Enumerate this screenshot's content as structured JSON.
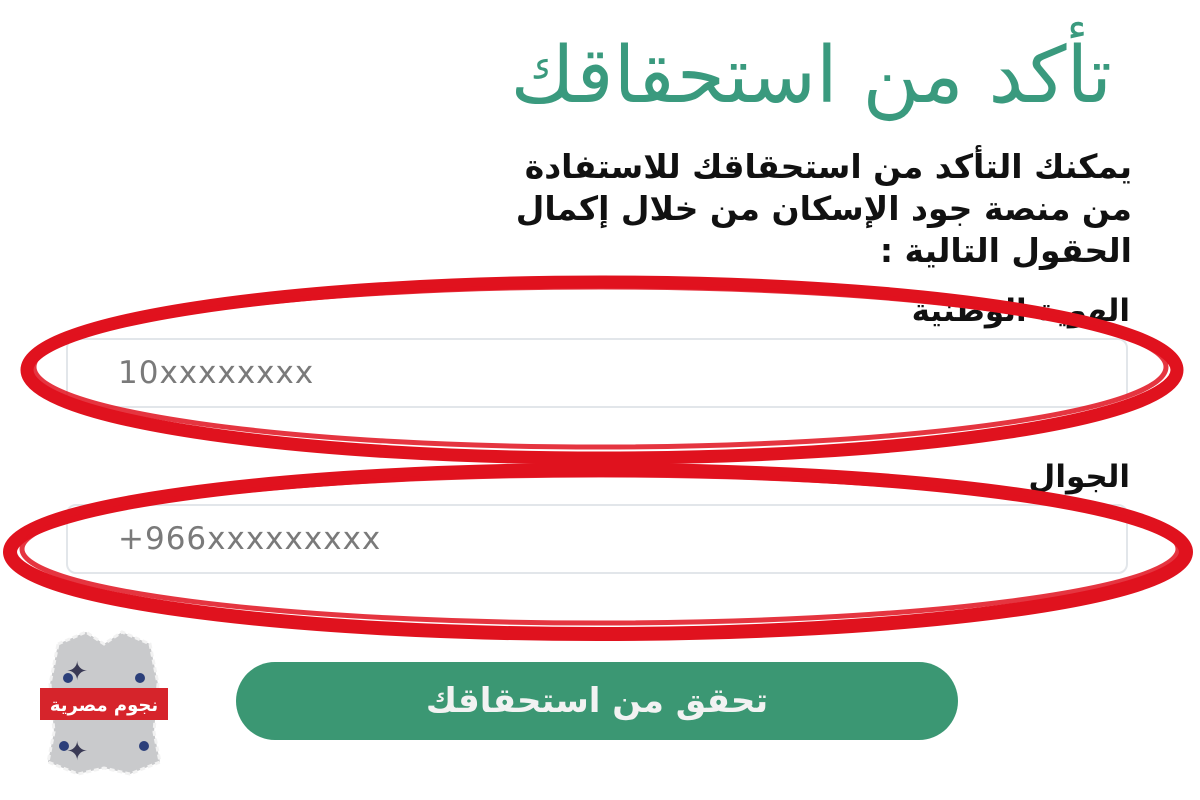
{
  "page": {
    "title": "تأكد من استحقاقك",
    "intro_lines": [
      "يمكنك التأكد من استحقاقك للاستفادة",
      "من منصة جود الإسكان من خلال إكمال",
      "الحقول التالية :"
    ]
  },
  "form": {
    "national_id": {
      "label": "الهوية الوطنية",
      "placeholder": "10xxxxxxxx"
    },
    "mobile": {
      "label": "الجوال",
      "placeholder": "+966xxxxxxxxx"
    },
    "submit_label": "تحقق من استحقاقك"
  },
  "watermark": {
    "text": "نجوم مصرية"
  },
  "colors": {
    "title": "#3a9a7e",
    "button": "#3b9773",
    "annotation": "#e0121e"
  }
}
